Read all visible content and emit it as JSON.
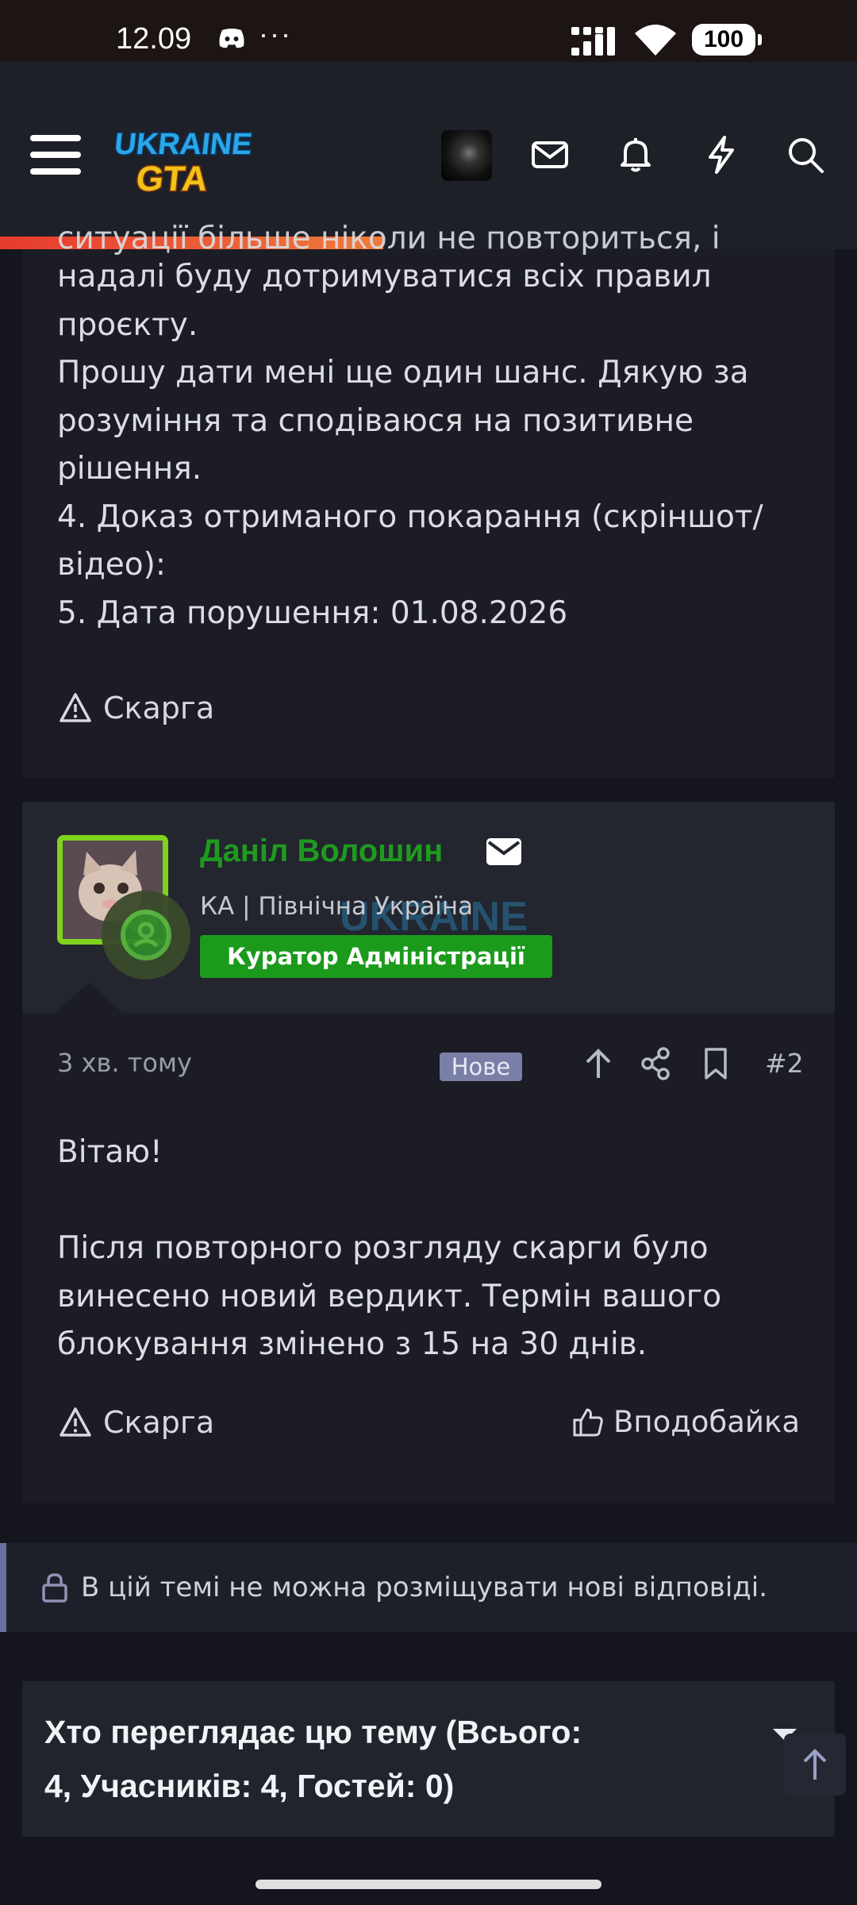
{
  "status_bar": {
    "time": "12.09",
    "overflow": "···",
    "battery": "100",
    "icons": [
      "discord-icon",
      "signal-icon",
      "wifi-icon",
      "battery-icon"
    ]
  },
  "header": {
    "logo_line1": "UKRAINE",
    "logo_line2": "GTA",
    "icons": [
      "menu-icon",
      "avatar",
      "inbox-icon",
      "bell-icon",
      "lightning-icon",
      "search-icon"
    ],
    "accent_color": "#e63b2e"
  },
  "post1": {
    "clipped_top": "ситуації більше ніколи не повториться, і",
    "lines": [
      "надалі буду дотримуватися всіх правил",
      "проєкту.",
      "Прошу дати мені ще один шанс. Дякую за",
      "розуміння та сподіваюся на позитивне",
      "рішення.",
      "4. Доказ отриманого покарання (скріншот/",
      "відео):",
      "5. Дата порушення: 01.08.2026"
    ],
    "report_label": "Скарга"
  },
  "post2": {
    "username": "Даніл Волошин",
    "user_title": "КА | Північна Україна",
    "role": "Куратор Адміністрації",
    "username_color": "#1f9a1f",
    "time": "3 хв. тому",
    "new_badge": "Нове",
    "post_number": "#2",
    "lines": [
      "Вітаю!",
      "",
      "Після повторного розгляду скарги було",
      "винесено новий вердикт. Термін вашого",
      "блокування змінено з 15 на 30 днів."
    ],
    "report_label": "Скарга",
    "like_label": "Вподобайка"
  },
  "locked_notice": "В цій темі не можна розміщувати нові відповіді.",
  "viewers": {
    "title_line1": "Хто переглядає цю тему (Всього:",
    "title_line2": "4, Учасників: 4, Гостей: 0)"
  }
}
